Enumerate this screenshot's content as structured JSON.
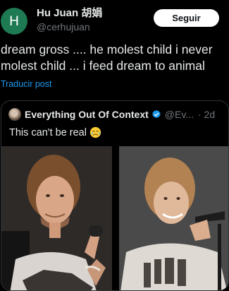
{
  "tweet": {
    "avatar_letter": "H",
    "author_name": "Hu Juan 胡娟",
    "author_handle": "@cerhujuan",
    "follow_label": "Seguir",
    "text": "dream gross .... he molest child i never\nmolest child ... i feed dream to animal",
    "translate_label": "Traducir post"
  },
  "quote": {
    "author_name": "Everything Out Of Context",
    "author_handle": "@Ev...",
    "time": "· 2d",
    "text": "This can't be real",
    "emoji": "crying-face-icon"
  },
  "colors": {
    "background": "#000000",
    "text": "#e7e9ea",
    "muted": "#71767b",
    "link": "#1d9bf0",
    "avatar": "#1e7a52",
    "verified": "#1d9bf0"
  }
}
